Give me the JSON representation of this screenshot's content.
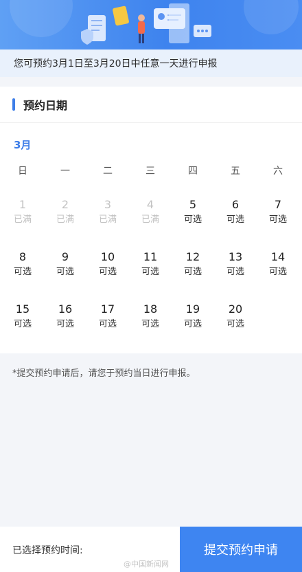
{
  "notice": {
    "text": "您可预约3月1日至3月20日中任意一天进行申报"
  },
  "section": {
    "title": "预约日期"
  },
  "calendar": {
    "month": "3月",
    "weekdays": [
      "日",
      "一",
      "二",
      "三",
      "四",
      "五",
      "六"
    ],
    "days": [
      {
        "num": "1",
        "status": "已满"
      },
      {
        "num": "2",
        "status": "已满"
      },
      {
        "num": "3",
        "status": "已满"
      },
      {
        "num": "4",
        "status": "已满"
      },
      {
        "num": "5",
        "status": "可选"
      },
      {
        "num": "6",
        "status": "可选"
      },
      {
        "num": "7",
        "status": "可选"
      },
      {
        "num": "8",
        "status": "可选"
      },
      {
        "num": "9",
        "status": "可选"
      },
      {
        "num": "10",
        "status": "可选"
      },
      {
        "num": "11",
        "status": "可选"
      },
      {
        "num": "12",
        "status": "可选"
      },
      {
        "num": "13",
        "status": "可选"
      },
      {
        "num": "14",
        "status": "可选"
      },
      {
        "num": "15",
        "status": "可选"
      },
      {
        "num": "16",
        "status": "可选"
      },
      {
        "num": "17",
        "status": "可选"
      },
      {
        "num": "18",
        "status": "可选"
      },
      {
        "num": "19",
        "status": "可选"
      },
      {
        "num": "20",
        "status": "可选"
      }
    ]
  },
  "note": {
    "text": "*提交预约申请后，请您于预约当日进行申报。"
  },
  "footer": {
    "selected_label": "已选择预约时间:",
    "submit_label": "提交预约申请"
  },
  "watermark": {
    "text": "@中国新闻网"
  },
  "colors": {
    "accent": "#3e85f1",
    "full": "#c2c2c2"
  }
}
